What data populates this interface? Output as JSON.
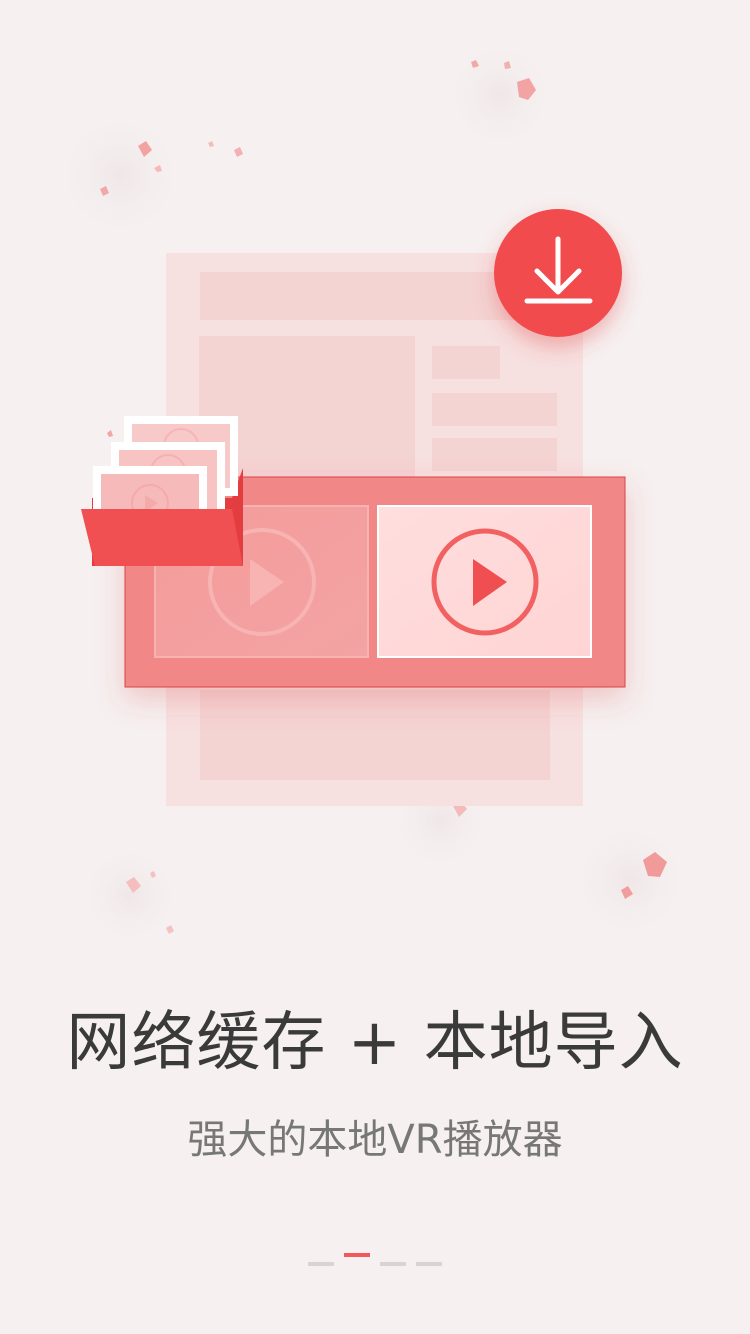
{
  "slide": {
    "title": "网络缓存 + 本地导入",
    "subtitle": "强大的本地VR播放器"
  },
  "icons": {
    "download": "download-icon",
    "folder": "folder-icon",
    "play": "play-icon"
  },
  "colors": {
    "accent": "#f2575a",
    "background": "#f6f0f0",
    "title_text": "#3a3a3a",
    "subtitle_text": "#777777",
    "dot_inactive": "#d9d4d4"
  },
  "pager": {
    "total": 4,
    "active_index": 1
  }
}
